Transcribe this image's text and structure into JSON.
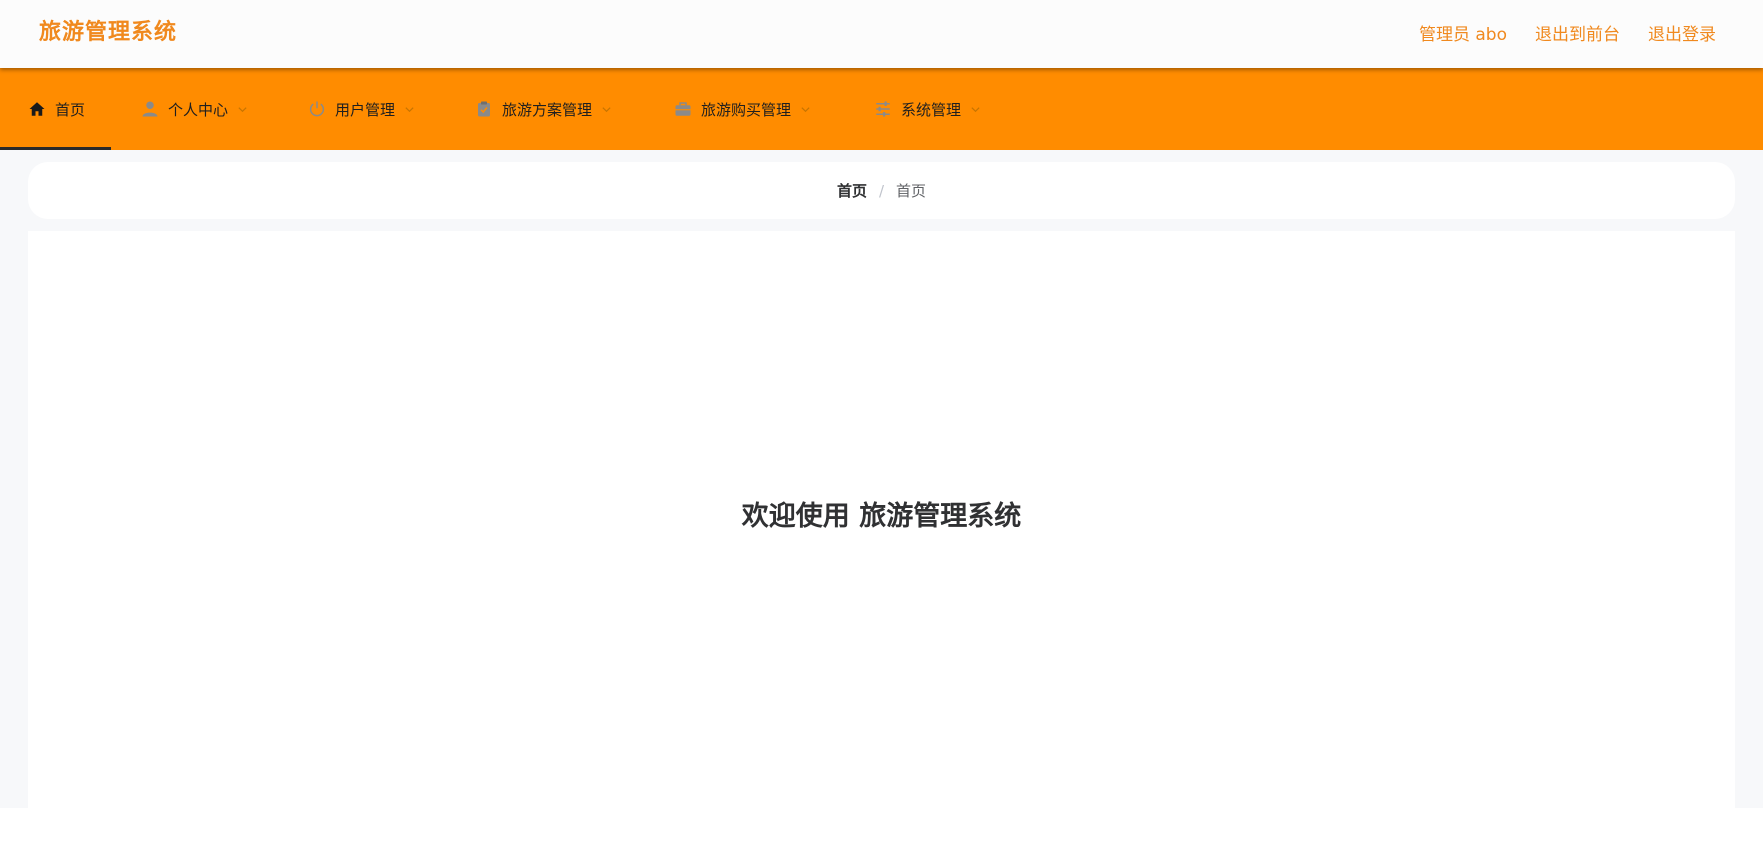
{
  "header": {
    "title": "旅游管理系统",
    "links": {
      "admin": "管理员 abo",
      "frontend": "退出到前台",
      "logout": "退出登录"
    }
  },
  "nav": {
    "items": [
      {
        "label": "首页",
        "icon": "home-icon"
      },
      {
        "label": "个人中心",
        "icon": "user-icon"
      },
      {
        "label": "用户管理",
        "icon": "power-icon"
      },
      {
        "label": "旅游方案管理",
        "icon": "clipboard-icon"
      },
      {
        "label": "旅游购买管理",
        "icon": "briefcase-icon"
      },
      {
        "label": "系统管理",
        "icon": "sliders-icon"
      }
    ]
  },
  "breadcrumb": {
    "first": "首页",
    "separator": "/",
    "last": "首页"
  },
  "main": {
    "welcome": "欢迎使用 旅游管理系统"
  },
  "colors": {
    "accent": "#ff8c00",
    "title": "#f0891e"
  }
}
